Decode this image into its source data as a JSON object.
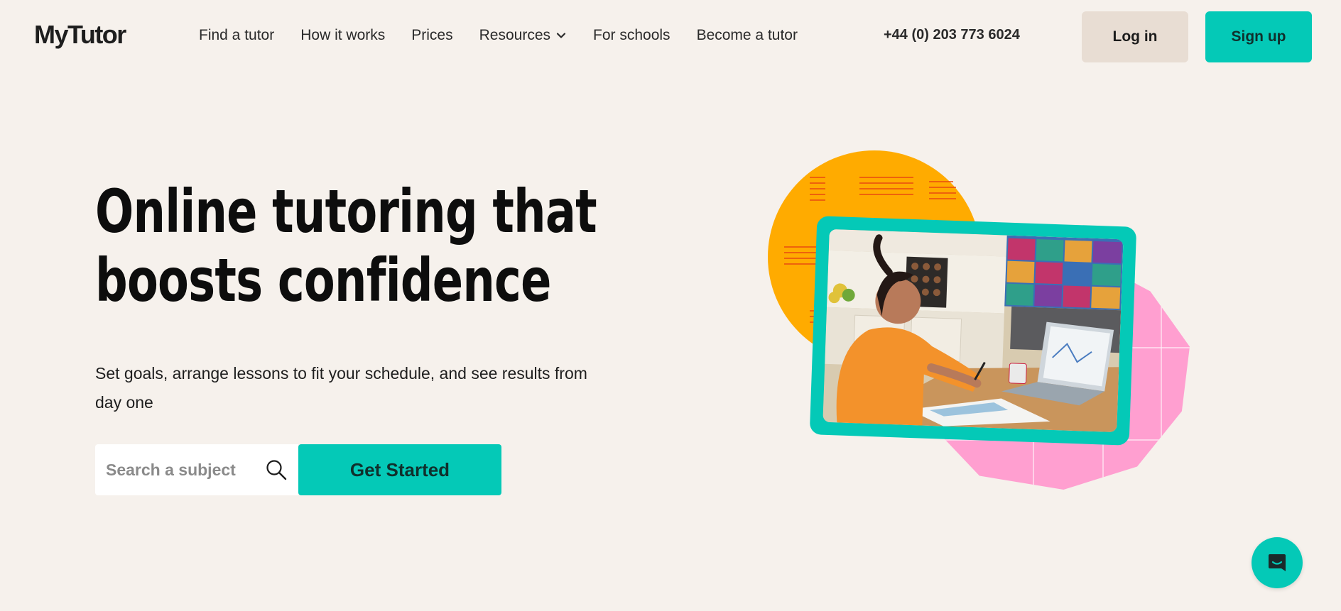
{
  "header": {
    "logo": "MyTutor",
    "nav": [
      {
        "label": "Find a tutor"
      },
      {
        "label": "How it works"
      },
      {
        "label": "Prices"
      },
      {
        "label": "Resources",
        "icon": "chevron-down-icon"
      },
      {
        "label": "For schools"
      },
      {
        "label": "Become a tutor"
      }
    ],
    "phone": "+44 (0) 203 773 6024",
    "login_label": "Log in",
    "signup_label": "Sign up"
  },
  "hero": {
    "title_line1": "Online tutoring that",
    "title_line2": "boosts confidence",
    "subtitle": "Set goals, arrange lessons to fit your schedule, and see results from day one",
    "search_placeholder": "Search a subject",
    "search_icon": "search-icon",
    "cta_label": "Get Started"
  },
  "illustration": {
    "photo_subject": "student-studying-at-laptop",
    "colors": {
      "orange": "#ffab00",
      "pink": "#ff9fd0",
      "teal": "#04c9b7"
    }
  },
  "chat": {
    "icon": "chat-icon"
  },
  "colors": {
    "background": "#f6f1ec",
    "accent": "#04c9b7",
    "login_bg": "#e8ddd3",
    "text": "#1c1c1c"
  }
}
